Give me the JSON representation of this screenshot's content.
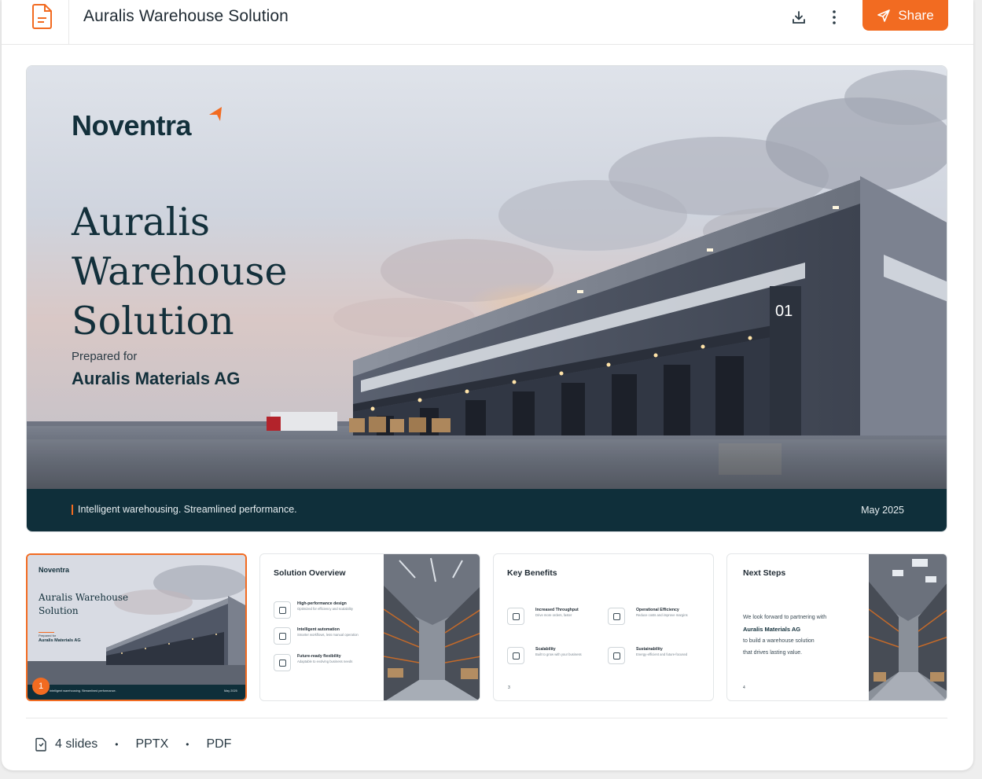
{
  "header": {
    "title": "Auralis Warehouse Solution",
    "share_label": "Share",
    "accent": "#f26b21"
  },
  "hero": {
    "logo": "Noventra",
    "title": "Auralis Warehouse Solution",
    "prepared_label": "Prepared for",
    "client": "Auralis Materials AG",
    "tagline": "Intelligent warehousing. Streamlined performance.",
    "date": "May 2025",
    "building_label": "01",
    "footer_color": "#0f2f3a"
  },
  "thumbnails": [
    {
      "logo": "Noventra",
      "title": "Auralis Warehouse Solution",
      "prepared_label": "Prepared for",
      "client": "Auralis Materials AG",
      "tagline": "Intelligent warehousing. Streamlined performance.",
      "date": "May 2025",
      "badge": "1"
    },
    {
      "title": "Solution Overview",
      "items": [
        {
          "heading": "High-performance design",
          "sub": "Optimized for efficiency and scalability"
        },
        {
          "heading": "Intelligent automation",
          "sub": "Smarter workflows, less manual operation"
        },
        {
          "heading": "Future-ready flexibility",
          "sub": "Adaptable to evolving business needs"
        }
      ]
    },
    {
      "title": "Key Benefits",
      "items": [
        {
          "heading": "Increased Throughput",
          "sub": "Drive more orders, faster"
        },
        {
          "heading": "Operational Efficiency",
          "sub": "Reduce costs and improve margins"
        },
        {
          "heading": "Scalability",
          "sub": "Built to grow with your business"
        },
        {
          "heading": "Sustainability",
          "sub": "Energy-efficient and future-focused"
        }
      ],
      "page": "3"
    },
    {
      "title": "Next Steps",
      "line1": "We look forward to partnering with",
      "client": "Auralis Materials AG",
      "line3": "to build a warehouse solution",
      "line4": "that drives lasting value.",
      "page": "4"
    }
  ],
  "meta": {
    "slides": "4 slides",
    "format1": "PPTX",
    "format2": "PDF",
    "separator": "•"
  }
}
